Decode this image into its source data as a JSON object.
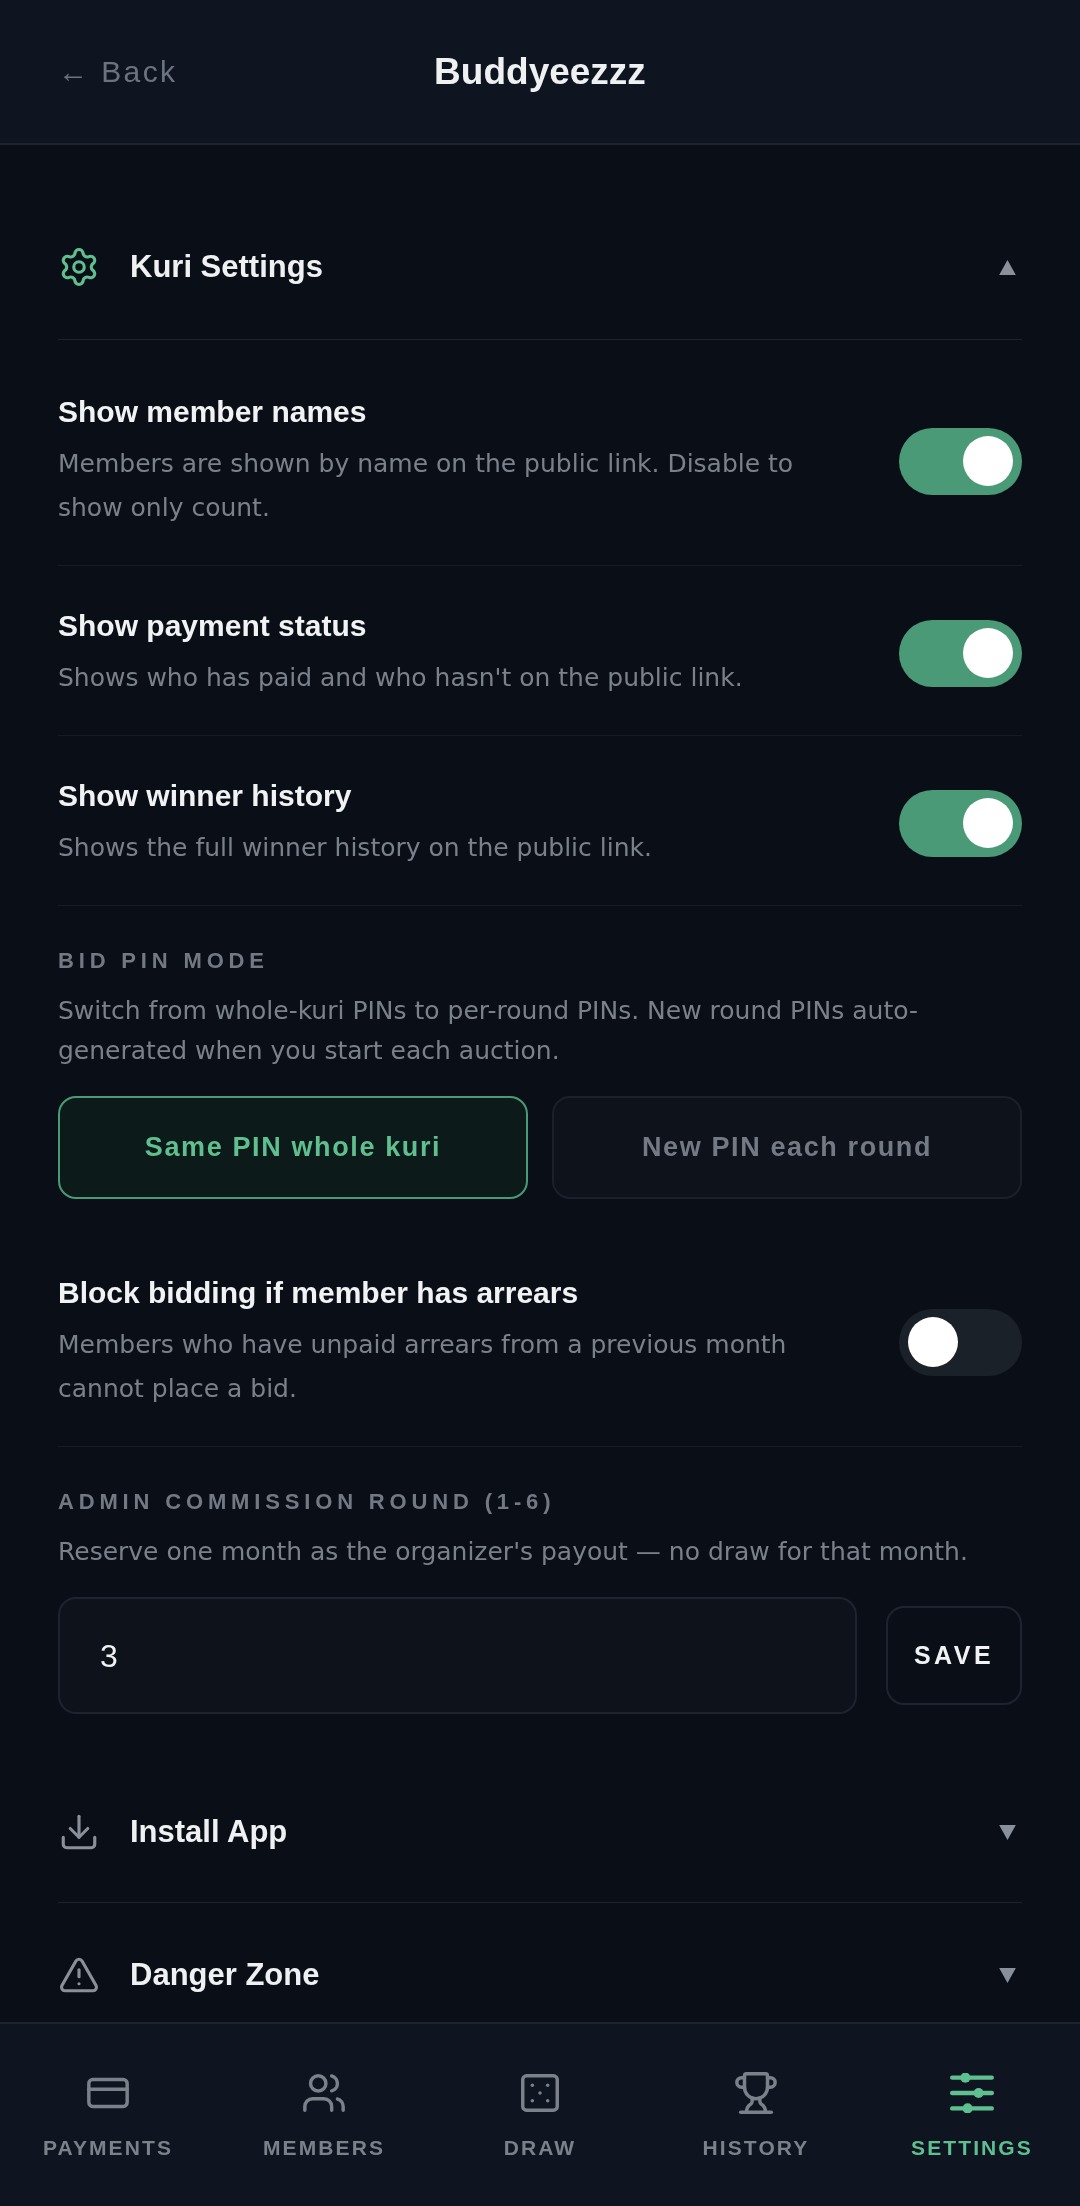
{
  "header": {
    "back": "← Back",
    "title": "Buddyeezzz"
  },
  "sections": [
    {
      "kind": "settings",
      "title": "Kuri Settings",
      "expanded": true,
      "items": [
        {
          "kind": "toggle",
          "title": "Show member names",
          "description": "Members are shown by name on the public link. Disable to show only count.",
          "on": true
        },
        {
          "kind": "toggle",
          "title": "Show payment status",
          "description": "Shows who has paid and who hasn't on the public link.",
          "on": true
        },
        {
          "kind": "toggle",
          "title": "Show winner history",
          "description": "Shows the full winner history on the public link.",
          "on": true
        },
        {
          "kind": "choice",
          "label": "BID PIN MODE",
          "description": "Switch from whole-kuri PINs to per-round PINs. New round PINs auto-generated when you start each auction.",
          "options": [
            {
              "label": "Same PIN whole kuri",
              "selected": true
            },
            {
              "label": "New PIN each round",
              "selected": false
            }
          ]
        },
        {
          "kind": "toggle",
          "title": "Block bidding if member has arrears",
          "description": "Members who have unpaid arrears from a previous month cannot place a bid.",
          "on": false
        },
        {
          "kind": "number",
          "label": "ADMIN COMMISSION ROUND (1-6)",
          "description": "Reserve one month as the organizer's payout — no draw for that month.",
          "value": "3",
          "button": "SAVE"
        }
      ]
    },
    {
      "kind": "install",
      "title": "Install App",
      "expanded": false
    },
    {
      "kind": "danger",
      "title": "Danger Zone",
      "expanded": false
    }
  ],
  "nav": [
    {
      "kind": "payments",
      "label": "PAYMENTS",
      "selected": false
    },
    {
      "kind": "members",
      "label": "MEMBERS",
      "selected": false
    },
    {
      "kind": "draw",
      "label": "DRAW",
      "selected": false
    },
    {
      "kind": "history",
      "label": "HISTORY",
      "selected": false
    },
    {
      "kind": "settings",
      "label": "SETTINGS",
      "selected": true
    }
  ]
}
